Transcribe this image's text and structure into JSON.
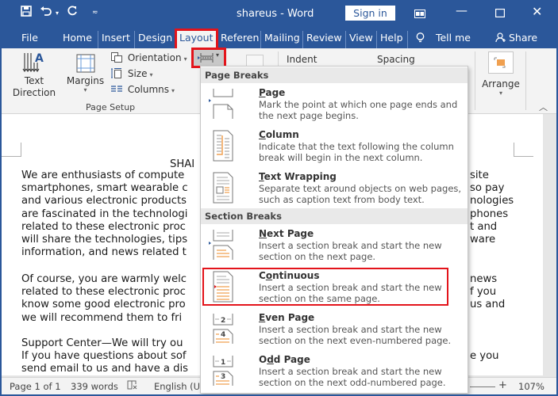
{
  "title_bar": {
    "doc_title": "shareus  -  Word",
    "sign_in": "Sign in",
    "qat_icons": [
      "save-icon",
      "undo-icon",
      "redo-icon",
      "customize-icon"
    ]
  },
  "tabs": [
    {
      "label": "File"
    },
    {
      "label": "Home"
    },
    {
      "label": "Insert"
    },
    {
      "label": "Design"
    },
    {
      "label": "Layout",
      "active": true
    },
    {
      "label": "Referen"
    },
    {
      "label": "Mailing"
    },
    {
      "label": "Review"
    },
    {
      "label": "View"
    },
    {
      "label": "Help"
    }
  ],
  "tell_me": "Tell me",
  "share": "Share",
  "ribbon": {
    "text_direction": "Text Direction",
    "margins": "Margins",
    "orientation": "Orientation",
    "size": "Size",
    "columns": "Columns",
    "page_setup_label": "Page Setup",
    "indent": "Indent",
    "spacing": "Spacing",
    "arrange": "Arrange"
  },
  "document": {
    "heading": "SHAI",
    "para1": [
      "We are enthusiasts of compute",
      "smartphones, smart wearable c",
      "and various electronic products",
      "are fascinated in the technologi",
      "related to these electronic proc",
      "will share the technologies, tips",
      "information, and news related t"
    ],
    "para1_right": [
      "site",
      "so pay",
      "nologies",
      "phones",
      "t and",
      "ware",
      ""
    ],
    "para2": [
      "Of course, you are warmly welc",
      "related to these electronic proc",
      "know some good electronic pro",
      "we will recommend them to fri"
    ],
    "para2_right": [
      "news",
      "f you",
      "us and",
      ""
    ],
    "para3": [
      "Support Center—We will try ou",
      "If you have questions about sof",
      "send email to us and have a dis"
    ],
    "para3_right": [
      "",
      "e you",
      ""
    ]
  },
  "breaks_menu": {
    "page_breaks_header": "Page Breaks",
    "section_breaks_header": "Section Breaks",
    "items": [
      {
        "title": "Page",
        "mnemonic": "P",
        "rest": "age",
        "desc": "Mark the point at which one page ends and the next page begins."
      },
      {
        "title": "Column",
        "mnemonic": "C",
        "rest": "olumn",
        "desc": "Indicate that the text following the column break will begin in the next column."
      },
      {
        "title": "Text Wrapping",
        "mnemonic": "T",
        "rest": "ext Wrapping",
        "desc": "Separate text around objects on web pages, such as caption text from body text."
      },
      {
        "title": "Next Page",
        "mnemonic": "N",
        "rest": "ext Page",
        "desc": "Insert a section break and start the new section on the next page."
      },
      {
        "title": "Continuous",
        "pre": "C",
        "mnemonic": "o",
        "rest": "ntinuous",
        "desc": "Insert a section break and start the new section on the same page.",
        "highlighted": true
      },
      {
        "title": "Even Page",
        "mnemonic": "E",
        "rest": "ven Page",
        "desc": "Insert a section break and start the new section on the next even-numbered page."
      },
      {
        "title": "Odd Page",
        "pre": "O",
        "mnemonic": "d",
        "rest": "d Page",
        "desc": "Insert a section break and start the new section on the next odd-numbered page."
      }
    ]
  },
  "status_bar": {
    "page": "Page 1 of 1",
    "words": "339 words",
    "language": "English (U",
    "zoom_plus": "+",
    "zoom": "107%"
  },
  "colors": {
    "accent": "#2b579a",
    "highlight": "#e3141b",
    "icon_orange": "#f0a050"
  }
}
